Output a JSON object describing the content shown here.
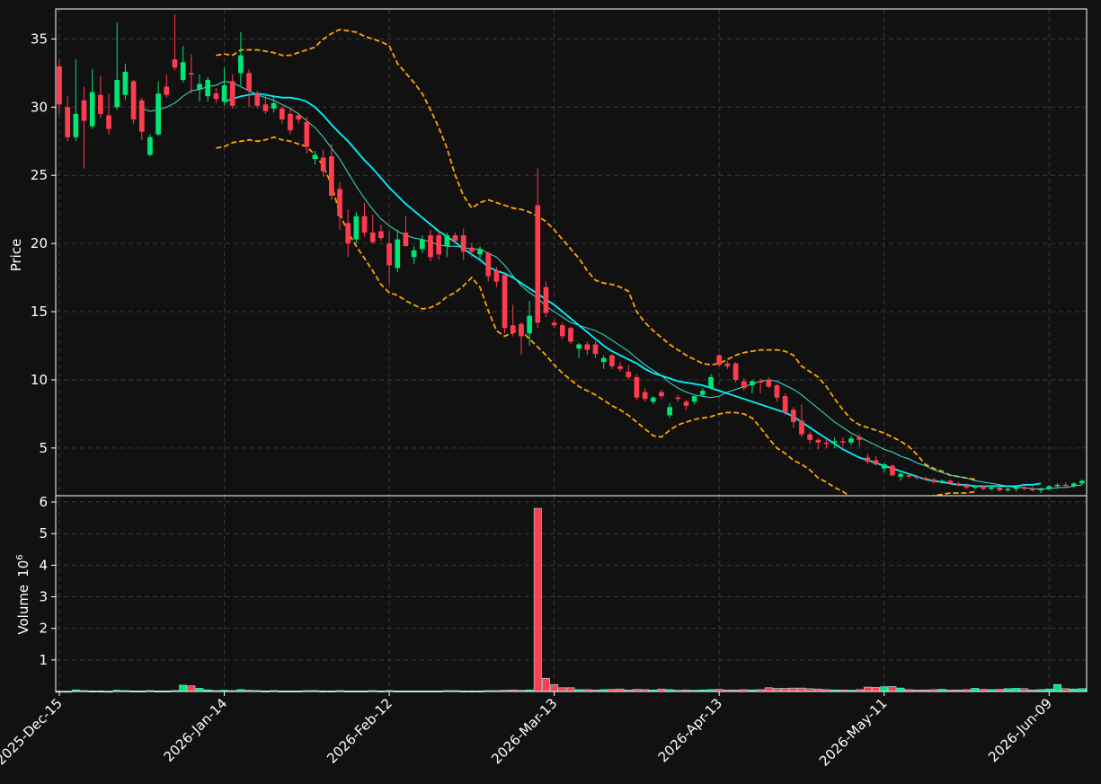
{
  "chart_data": {
    "type": "candlestick",
    "theme": {
      "background": "#111111",
      "up_color": "#00e676",
      "down_color": "#ff3d4f",
      "ma_fast_color": "#40e0d0",
      "ma_slow_color": "#00f5ff",
      "band_color": "#ffa500",
      "volume_edge_color": "#80ffff",
      "grid": true
    },
    "price_panel": {
      "ylabel": "Price",
      "ylim": [
        1.5,
        37.2
      ],
      "yticks": [
        5,
        10,
        15,
        20,
        25,
        30,
        35
      ]
    },
    "volume_panel": {
      "ylabel": "Volume",
      "ylabel_exponent": "10",
      "ylabel_exponent_power": "6",
      "ylim": [
        0,
        6.2
      ],
      "yticks": [
        1,
        2,
        3,
        4,
        5,
        6
      ]
    },
    "x_ticks": [
      {
        "index": 0,
        "label": "2025-Dec-15"
      },
      {
        "index": 20,
        "label": "2026-Jan-14"
      },
      {
        "index": 40,
        "label": "2026-Feb-12"
      },
      {
        "index": 60,
        "label": "2026-Mar-13"
      },
      {
        "index": 80,
        "label": "2026-Apr-13"
      },
      {
        "index": 100,
        "label": "2026-May-11"
      },
      {
        "index": 120,
        "label": "2026-Jun-09"
      }
    ],
    "candles": [
      [
        0,
        33.0,
        33.5,
        29.5,
        30.2
      ],
      [
        1,
        30.0,
        30.8,
        27.5,
        27.8
      ],
      [
        2,
        27.8,
        33.5,
        27.5,
        29.5
      ],
      [
        3,
        30.5,
        31.5,
        25.5,
        29.0
      ],
      [
        4,
        28.6,
        32.8,
        28.4,
        31.1
      ],
      [
        5,
        30.9,
        32.3,
        29.2,
        29.5
      ],
      [
        6,
        29.4,
        31.0,
        28.0,
        28.4
      ],
      [
        7,
        30.0,
        36.2,
        29.8,
        32.0
      ],
      [
        8,
        30.9,
        33.2,
        30.5,
        32.6
      ],
      [
        9,
        31.9,
        32.0,
        28.8,
        29.1
      ],
      [
        10,
        30.5,
        30.7,
        27.6,
        28.2
      ],
      [
        11,
        26.5,
        28.0,
        26.4,
        27.8
      ],
      [
        12,
        28.0,
        31.9,
        27.9,
        31.0
      ],
      [
        13,
        31.5,
        32.4,
        30.7,
        30.9
      ],
      [
        14,
        33.5,
        36.8,
        32.7,
        32.9
      ],
      [
        15,
        32.0,
        34.5,
        31.8,
        33.3
      ],
      [
        16,
        32.5,
        33.9,
        31.0,
        32.4
      ],
      [
        17,
        31.3,
        32.4,
        30.4,
        31.7
      ],
      [
        18,
        30.8,
        32.2,
        30.4,
        32.0
      ],
      [
        19,
        31.0,
        31.4,
        30.3,
        30.6
      ],
      [
        20,
        30.4,
        32.9,
        30.1,
        31.6
      ],
      [
        21,
        31.9,
        32.4,
        29.9,
        30.1
      ],
      [
        22,
        32.5,
        35.5,
        31.6,
        33.8
      ],
      [
        23,
        32.5,
        32.8,
        30.0,
        31.2
      ],
      [
        24,
        31.0,
        31.2,
        29.9,
        30.1
      ],
      [
        25,
        30.2,
        31.0,
        29.5,
        29.7
      ],
      [
        26,
        29.9,
        30.8,
        29.6,
        30.3
      ],
      [
        27,
        29.9,
        30.1,
        28.8,
        29.1
      ],
      [
        28,
        29.5,
        30.0,
        28.0,
        28.3
      ],
      [
        29,
        29.4,
        29.6,
        28.8,
        29.1
      ],
      [
        30,
        28.9,
        29.3,
        26.6,
        27.1
      ],
      [
        31,
        26.2,
        26.8,
        25.8,
        26.5
      ],
      [
        32,
        26.3,
        26.9,
        24.9,
        25.3
      ],
      [
        33,
        26.4,
        27.3,
        23.2,
        23.5
      ],
      [
        34,
        24.0,
        24.5,
        21.0,
        22.0
      ],
      [
        35,
        21.5,
        22.5,
        19.0,
        20.0
      ],
      [
        36,
        20.3,
        22.3,
        20.0,
        22.0
      ],
      [
        37,
        22.0,
        23.0,
        20.5,
        20.8
      ],
      [
        38,
        20.8,
        22.1,
        20.0,
        20.1
      ],
      [
        39,
        20.9,
        21.4,
        20.2,
        20.4
      ],
      [
        40,
        20.0,
        20.9,
        17.0,
        18.4
      ],
      [
        41,
        18.2,
        21.0,
        17.9,
        20.3
      ],
      [
        42,
        20.8,
        22.0,
        19.8,
        19.8
      ],
      [
        43,
        19.0,
        19.8,
        18.5,
        19.5
      ],
      [
        44,
        19.6,
        20.6,
        19.3,
        20.3
      ],
      [
        45,
        20.6,
        21.0,
        18.7,
        19.0
      ],
      [
        46,
        20.6,
        21.0,
        18.8,
        19.2
      ],
      [
        47,
        19.8,
        20.8,
        19.0,
        20.6
      ],
      [
        48,
        20.6,
        20.8,
        20.0,
        20.2
      ],
      [
        49,
        20.6,
        21.1,
        18.8,
        19.4
      ],
      [
        50,
        19.7,
        20.0,
        19.0,
        19.4
      ],
      [
        51,
        19.2,
        19.8,
        18.9,
        19.6
      ],
      [
        52,
        19.3,
        19.4,
        17.2,
        17.6
      ],
      [
        53,
        18.0,
        18.3,
        16.8,
        17.2
      ],
      [
        54,
        17.7,
        17.7,
        13.4,
        13.8
      ],
      [
        55,
        14.0,
        15.5,
        13.2,
        13.5
      ],
      [
        56,
        14.1,
        14.2,
        11.8,
        13.2
      ],
      [
        57,
        13.4,
        15.8,
        12.5,
        14.7
      ],
      [
        58,
        22.8,
        25.5,
        13.8,
        14.2
      ],
      [
        59,
        16.8,
        17.2,
        14.6,
        14.9
      ],
      [
        60,
        14.2,
        14.4,
        13.8,
        14.0
      ],
      [
        61,
        14.0,
        14.2,
        13.0,
        13.2
      ],
      [
        62,
        13.8,
        13.9,
        12.6,
        12.8
      ],
      [
        63,
        12.3,
        12.7,
        11.6,
        12.6
      ],
      [
        64,
        12.6,
        12.8,
        11.8,
        12.2
      ],
      [
        65,
        12.6,
        12.8,
        11.6,
        11.9
      ],
      [
        66,
        11.3,
        11.8,
        10.8,
        11.6
      ],
      [
        67,
        11.8,
        11.9,
        10.8,
        11.0
      ],
      [
        68,
        11.0,
        11.3,
        10.6,
        10.8
      ],
      [
        69,
        10.6,
        11.1,
        10.0,
        10.2
      ],
      [
        70,
        10.2,
        10.4,
        8.5,
        8.7
      ],
      [
        71,
        9.1,
        9.4,
        8.4,
        8.6
      ],
      [
        72,
        8.4,
        8.8,
        8.2,
        8.7
      ],
      [
        73,
        9.1,
        9.3,
        8.6,
        8.8
      ],
      [
        74,
        7.4,
        8.3,
        7.2,
        8.0
      ],
      [
        75,
        8.7,
        8.9,
        8.4,
        8.6
      ],
      [
        76,
        8.4,
        8.5,
        7.8,
        8.1
      ],
      [
        77,
        8.4,
        8.9,
        8.2,
        8.8
      ],
      [
        78,
        8.9,
        9.4,
        8.8,
        9.2
      ],
      [
        79,
        9.4,
        10.4,
        9.3,
        10.2
      ],
      [
        80,
        11.8,
        11.9,
        11.0,
        11.1
      ],
      [
        81,
        11.2,
        11.4,
        10.8,
        11.0
      ],
      [
        82,
        11.2,
        11.3,
        9.8,
        10.0
      ],
      [
        83,
        9.9,
        10.1,
        9.2,
        9.4
      ],
      [
        84,
        9.6,
        10.0,
        9.0,
        9.9
      ],
      [
        85,
        9.9,
        10.1,
        9.0,
        9.8
      ],
      [
        86,
        10.0,
        10.2,
        9.4,
        9.5
      ],
      [
        87,
        9.6,
        9.7,
        8.4,
        8.7
      ],
      [
        88,
        8.8,
        9.0,
        7.4,
        7.6
      ],
      [
        89,
        7.8,
        8.0,
        6.5,
        6.9
      ],
      [
        90,
        7.0,
        8.2,
        5.8,
        6.0
      ],
      [
        91,
        6.0,
        6.2,
        5.3,
        5.6
      ],
      [
        92,
        5.6,
        5.7,
        4.9,
        5.4
      ],
      [
        93,
        5.4,
        5.6,
        5.0,
        5.3
      ],
      [
        94,
        5.4,
        5.8,
        5.0,
        5.5
      ],
      [
        95,
        5.5,
        5.8,
        5.1,
        5.4
      ],
      [
        96,
        5.4,
        5.9,
        5.2,
        5.7
      ],
      [
        97,
        5.8,
        6.0,
        5.1,
        5.6
      ],
      [
        98,
        4.3,
        4.6,
        3.8,
        4.0
      ],
      [
        99,
        4.1,
        4.4,
        3.7,
        3.8
      ],
      [
        100,
        3.5,
        3.9,
        3.2,
        3.8
      ],
      [
        101,
        3.7,
        3.8,
        2.9,
        3.0
      ],
      [
        102,
        2.9,
        3.2,
        2.6,
        3.1
      ],
      [
        103,
        3.0,
        3.1,
        2.8,
        2.9
      ],
      [
        104,
        2.9,
        3.0,
        2.7,
        2.8
      ],
      [
        105,
        2.8,
        2.9,
        2.6,
        2.7
      ],
      [
        106,
        2.7,
        2.8,
        2.4,
        2.5
      ],
      [
        107,
        2.5,
        2.7,
        2.4,
        2.6
      ],
      [
        108,
        2.6,
        2.7,
        2.3,
        2.4
      ],
      [
        109,
        2.4,
        2.5,
        2.2,
        2.3
      ],
      [
        110,
        2.3,
        2.4,
        2.0,
        2.1
      ],
      [
        111,
        2.1,
        2.3,
        2.0,
        2.2
      ],
      [
        112,
        2.2,
        2.3,
        1.9,
        2.0
      ],
      [
        113,
        2.0,
        2.2,
        1.9,
        2.1
      ],
      [
        114,
        2.1,
        2.2,
        1.8,
        1.9
      ],
      [
        115,
        1.9,
        2.1,
        1.8,
        2.0
      ],
      [
        116,
        2.0,
        2.1,
        1.8,
        2.1
      ],
      [
        117,
        2.1,
        2.3,
        1.9,
        2.0
      ],
      [
        118,
        2.0,
        2.2,
        1.8,
        1.9
      ],
      [
        119,
        1.9,
        2.1,
        1.7,
        2.0
      ],
      [
        120,
        2.0,
        2.3,
        1.9,
        2.2
      ],
      [
        121,
        2.2,
        2.4,
        2.0,
        2.3
      ],
      [
        122,
        2.3,
        2.5,
        2.1,
        2.2
      ],
      [
        123,
        2.2,
        2.5,
        2.1,
        2.4
      ],
      [
        124,
        2.4,
        2.7,
        2.3,
        2.6
      ]
    ],
    "volume": [
      0.01,
      0.01,
      0.05,
      0.03,
      0.02,
      0.02,
      0.01,
      0.04,
      0.03,
      0.02,
      0.02,
      0.03,
      0.02,
      0.02,
      0.03,
      0.2,
      0.18,
      0.1,
      0.05,
      0.03,
      0.04,
      0.03,
      0.06,
      0.04,
      0.03,
      0.02,
      0.03,
      0.02,
      0.02,
      0.02,
      0.03,
      0.03,
      0.02,
      0.02,
      0.03,
      0.02,
      0.02,
      0.02,
      0.03,
      0.02,
      0.03,
      0.02,
      0.02,
      0.02,
      0.02,
      0.02,
      0.02,
      0.03,
      0.03,
      0.02,
      0.02,
      0.02,
      0.03,
      0.03,
      0.04,
      0.05,
      0.04,
      0.05,
      5.8,
      0.42,
      0.22,
      0.12,
      0.12,
      0.06,
      0.06,
      0.05,
      0.06,
      0.07,
      0.08,
      0.05,
      0.07,
      0.06,
      0.05,
      0.08,
      0.06,
      0.04,
      0.05,
      0.04,
      0.05,
      0.06,
      0.07,
      0.05,
      0.05,
      0.06,
      0.05,
      0.06,
      0.12,
      0.1,
      0.1,
      0.11,
      0.11,
      0.09,
      0.08,
      0.06,
      0.05,
      0.05,
      0.04,
      0.06,
      0.14,
      0.13,
      0.15,
      0.16,
      0.11,
      0.06,
      0.05,
      0.05,
      0.06,
      0.07,
      0.05,
      0.05,
      0.06,
      0.1,
      0.07,
      0.06,
      0.07,
      0.09,
      0.1,
      0.09,
      0.05,
      0.06,
      0.08,
      0.22,
      0.09,
      0.08,
      0.09
    ],
    "ma_fast": [
      null,
      null,
      null,
      null,
      null,
      null,
      null,
      null,
      null,
      null,
      29.9,
      29.7,
      29.8,
      30.0,
      30.3,
      30.8,
      31.2,
      31.3,
      31.5,
      31.6,
      31.9,
      31.8,
      31.5,
      31.2,
      30.9,
      30.7,
      30.5,
      30.2,
      29.9,
      29.5,
      29.0,
      28.5,
      27.8,
      27.0,
      26.2,
      25.2,
      24.2,
      23.3,
      22.5,
      21.8,
      21.3,
      20.9,
      20.6,
      20.4,
      20.3,
      20.1,
      19.9,
      19.8,
      19.8,
      19.7,
      19.6,
      19.6,
      19.3,
      19.0,
      18.4,
      17.6,
      16.9,
      16.4,
      16.0,
      15.4,
      15.0,
      14.6,
      14.2,
      14.0,
      13.8,
      13.6,
      13.3,
      12.9,
      12.5,
      12.1,
      11.6,
      11.1,
      10.7,
      10.3,
      9.8,
      9.4,
      9.1,
      8.9,
      8.8,
      8.7,
      8.8,
      9.1,
      9.3,
      9.5,
      9.7,
      9.9,
      10.0,
      9.9,
      9.6,
      9.3,
      8.9,
      8.4,
      7.9,
      7.4,
      6.9,
      6.5,
      6.1,
      5.8,
      5.5,
      5.2,
      4.9,
      4.7,
      4.4,
      4.2,
      3.9,
      3.7,
      3.4,
      3.2,
      3.0,
      2.9,
      2.8,
      2.6,
      2.5,
      2.4,
      2.3,
      2.2,
      2.1,
      2.1,
      2.0,
      2.0,
      2.0,
      2.1,
      2.1,
      2.2,
      2.3
    ],
    "ma_slow": [
      null,
      null,
      null,
      null,
      null,
      null,
      null,
      null,
      null,
      null,
      null,
      null,
      null,
      null,
      null,
      null,
      null,
      null,
      null,
      null,
      30.4,
      30.6,
      30.8,
      30.9,
      31.0,
      30.9,
      30.8,
      30.7,
      30.7,
      30.6,
      30.4,
      30.0,
      29.4,
      28.7,
      28.1,
      27.5,
      26.8,
      26.1,
      25.5,
      24.8,
      24.1,
      23.5,
      22.9,
      22.4,
      21.9,
      21.4,
      20.9,
      20.5,
      20.1,
      19.6,
      19.2,
      18.8,
      18.3,
      18.0,
      17.8,
      17.5,
      17.1,
      16.7,
      16.3,
      15.9,
      15.5,
      15.0,
      14.5,
      14.0,
      13.5,
      13.0,
      12.5,
      12.1,
      11.8,
      11.5,
      11.2,
      10.8,
      10.5,
      10.3,
      10.1,
      9.9,
      9.8,
      9.7,
      9.6,
      9.4,
      9.2,
      9.0,
      8.8,
      8.6,
      8.4,
      8.2,
      8.0,
      7.8,
      7.6,
      7.3,
      6.9,
      6.5,
      6.1,
      5.7,
      5.3,
      4.9,
      4.6,
      4.3,
      4.1,
      3.9,
      3.7,
      3.5,
      3.3,
      3.1,
      2.9,
      2.7,
      2.6,
      2.5,
      2.4,
      2.3,
      2.3,
      2.2,
      2.2,
      2.2,
      2.2,
      2.2,
      2.2,
      2.3,
      2.3,
      2.4
    ],
    "band_upper": [
      null,
      null,
      null,
      null,
      null,
      null,
      null,
      null,
      null,
      null,
      null,
      null,
      null,
      null,
      null,
      null,
      null,
      null,
      null,
      33.8,
      33.9,
      33.8,
      34.2,
      34.2,
      34.2,
      34.1,
      34.0,
      33.8,
      33.8,
      34.0,
      34.2,
      34.4,
      35.0,
      35.4,
      35.7,
      35.6,
      35.5,
      35.2,
      35.0,
      34.8,
      34.5,
      33.2,
      32.5,
      31.8,
      31.0,
      29.8,
      28.5,
      27.0,
      25.0,
      23.5,
      22.6,
      23.0,
      23.2,
      23.0,
      22.8,
      22.6,
      22.5,
      22.3,
      22.0,
      21.6,
      21.0,
      20.3,
      19.6,
      18.9,
      18.0,
      17.3,
      17.1,
      17.0,
      16.8,
      16.5,
      15.0,
      14.2,
      13.6,
      13.1,
      12.6,
      12.2,
      11.8,
      11.5,
      11.2,
      11.1,
      11.2,
      11.5,
      11.8,
      12.0,
      12.1,
      12.2,
      12.2,
      12.2,
      12.1,
      11.8,
      11.0,
      10.6,
      10.2,
      9.5,
      8.6,
      7.8,
      7.1,
      6.7,
      6.5,
      6.3,
      6.1,
      5.8,
      5.5,
      5.1,
      4.5,
      3.8,
      3.5,
      3.3,
      3.0,
      2.9,
      2.8,
      2.7
    ],
    "band_lower": [
      null,
      null,
      null,
      null,
      null,
      null,
      null,
      null,
      null,
      null,
      null,
      null,
      null,
      null,
      null,
      null,
      null,
      null,
      null,
      27.0,
      27.1,
      27.4,
      27.5,
      27.6,
      27.5,
      27.6,
      27.8,
      27.6,
      27.5,
      27.3,
      27.1,
      26.5,
      25.7,
      24.3,
      22.2,
      20.8,
      19.8,
      18.9,
      18.0,
      17.0,
      16.4,
      16.2,
      15.8,
      15.5,
      15.2,
      15.3,
      15.6,
      16.1,
      16.4,
      16.9,
      17.5,
      16.8,
      15.1,
      13.6,
      13.2,
      13.5,
      13.6,
      13.0,
      12.4,
      11.8,
      11.1,
      10.5,
      10.0,
      9.5,
      9.2,
      8.9,
      8.5,
      8.1,
      7.8,
      7.4,
      6.9,
      6.4,
      5.9,
      5.8,
      6.3,
      6.7,
      6.9,
      7.1,
      7.2,
      7.3,
      7.5,
      7.6,
      7.6,
      7.5,
      7.2,
      6.5,
      5.7,
      5.0,
      4.6,
      4.1,
      3.8,
      3.4,
      2.8,
      2.5,
      2.1,
      1.8,
      1.4,
      1.3,
      1.2,
      1.2,
      1.2,
      1.2,
      1.2,
      1.2,
      1.3,
      1.4,
      1.5,
      1.6,
      1.7,
      1.7,
      1.7,
      1.8
    ]
  }
}
